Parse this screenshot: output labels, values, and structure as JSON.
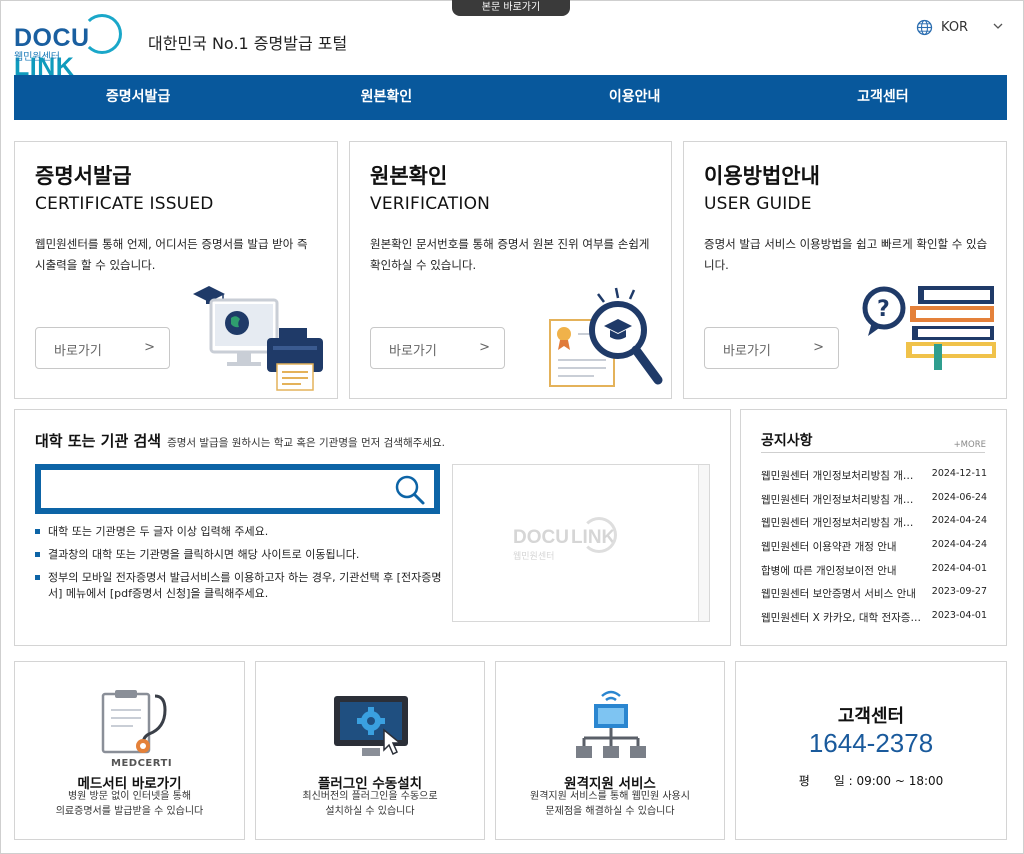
{
  "skip_link": "본문 바로가기",
  "logo": {
    "word_docu": "DOCU",
    "word_link": "LINK",
    "sub": "웹민원센터"
  },
  "tagline": "대한민국 No.1 증명발급 포털",
  "language": {
    "selected": "KOR"
  },
  "nav": [
    "증명서발급",
    "원본확인",
    "이용안내",
    "고객센터"
  ],
  "cards": [
    {
      "title": "증명서발급",
      "en": "CERTIFICATE ISSUED",
      "desc": "웹민원센터를 통해 언제, 어디서든 증명서를 발급 받아 즉시출력을 할 수 있습니다.",
      "button": "바로가기",
      "arrow": ">"
    },
    {
      "title": "원본확인",
      "en": "VERIFICATION",
      "desc": "원본확인 문서번호를 통해 증명서 원본 진위 여부를 손쉽게 확인하실 수 있습니다.",
      "button": "바로가기",
      "arrow": ">"
    },
    {
      "title": "이용방법안내",
      "en": "USER GUIDE",
      "desc": "증명서 발급 서비스 이용방법을 쉽고 빠르게 확인할 수 있습니다.",
      "button": "바로가기",
      "arrow": ">"
    }
  ],
  "search": {
    "title": "대학 또는 기관 검색",
    "hint": "증명서 발급을 원하시는 학교 혹은 기관명을 먼저 검색해주세요.",
    "value": "",
    "bullets": [
      "대학 또는 기관명은 두 글자 이상 입력해 주세요.",
      "결과창의 대학 또는 기관명을 클릭하시면 해당 사이트로 이동됩니다.",
      "정부의 모바일 전자증명서 발급서비스를 이용하고자 하는 경우, 기관선택 후 [전자증명서] 메뉴에서 [pdf증명서 신청]을 클릭해주세요."
    ]
  },
  "notice": {
    "title": "공지사항",
    "more": "+MORE",
    "items": [
      {
        "title": "웹민원센터 개인정보처리방침 개정 안내",
        "date": "2024-12-11"
      },
      {
        "title": "웹민원센터 개인정보처리방침 개정 안내",
        "date": "2024-06-24"
      },
      {
        "title": "웹민원센터 개인정보처리방침 개정 안내",
        "date": "2024-04-24"
      },
      {
        "title": "웹민원센터 이용약관 개정 안내",
        "date": "2024-04-24"
      },
      {
        "title": "합병에 따른 개인정보이전 안내",
        "date": "2024-04-01"
      },
      {
        "title": "웹민원센터 보안증명서 서비스 안내",
        "date": "2023-09-27"
      },
      {
        "title": "웹민원센터 X 카카오, 대학 전자증명서 안내",
        "date": "2023-04-01"
      }
    ]
  },
  "services": [
    {
      "badge": "MEDCERTI",
      "title": "메드서티 바로가기",
      "desc1": "병원 방문 없이 인터넷을 통해",
      "desc2": "의료증명서를 발급받을 수 있습니다"
    },
    {
      "title": "플러그인 수동설치",
      "desc1": "최신버전의 플러그인을 수동으로",
      "desc2": "설치하실 수 있습니다"
    },
    {
      "title": "원격지원 서비스",
      "desc1": "원격지원 서비스를 통해 웹민원 사용시",
      "desc2": "문제점을 해결하실 수 있습니다"
    }
  ],
  "customer": {
    "title": "고객센터",
    "phone": "1644-2378",
    "hours": "평　　일 : 09:00 ~ 18:00"
  },
  "colors": {
    "primary": "#08589c",
    "accent": "#0d64a6",
    "phone": "#1a5a9c"
  }
}
